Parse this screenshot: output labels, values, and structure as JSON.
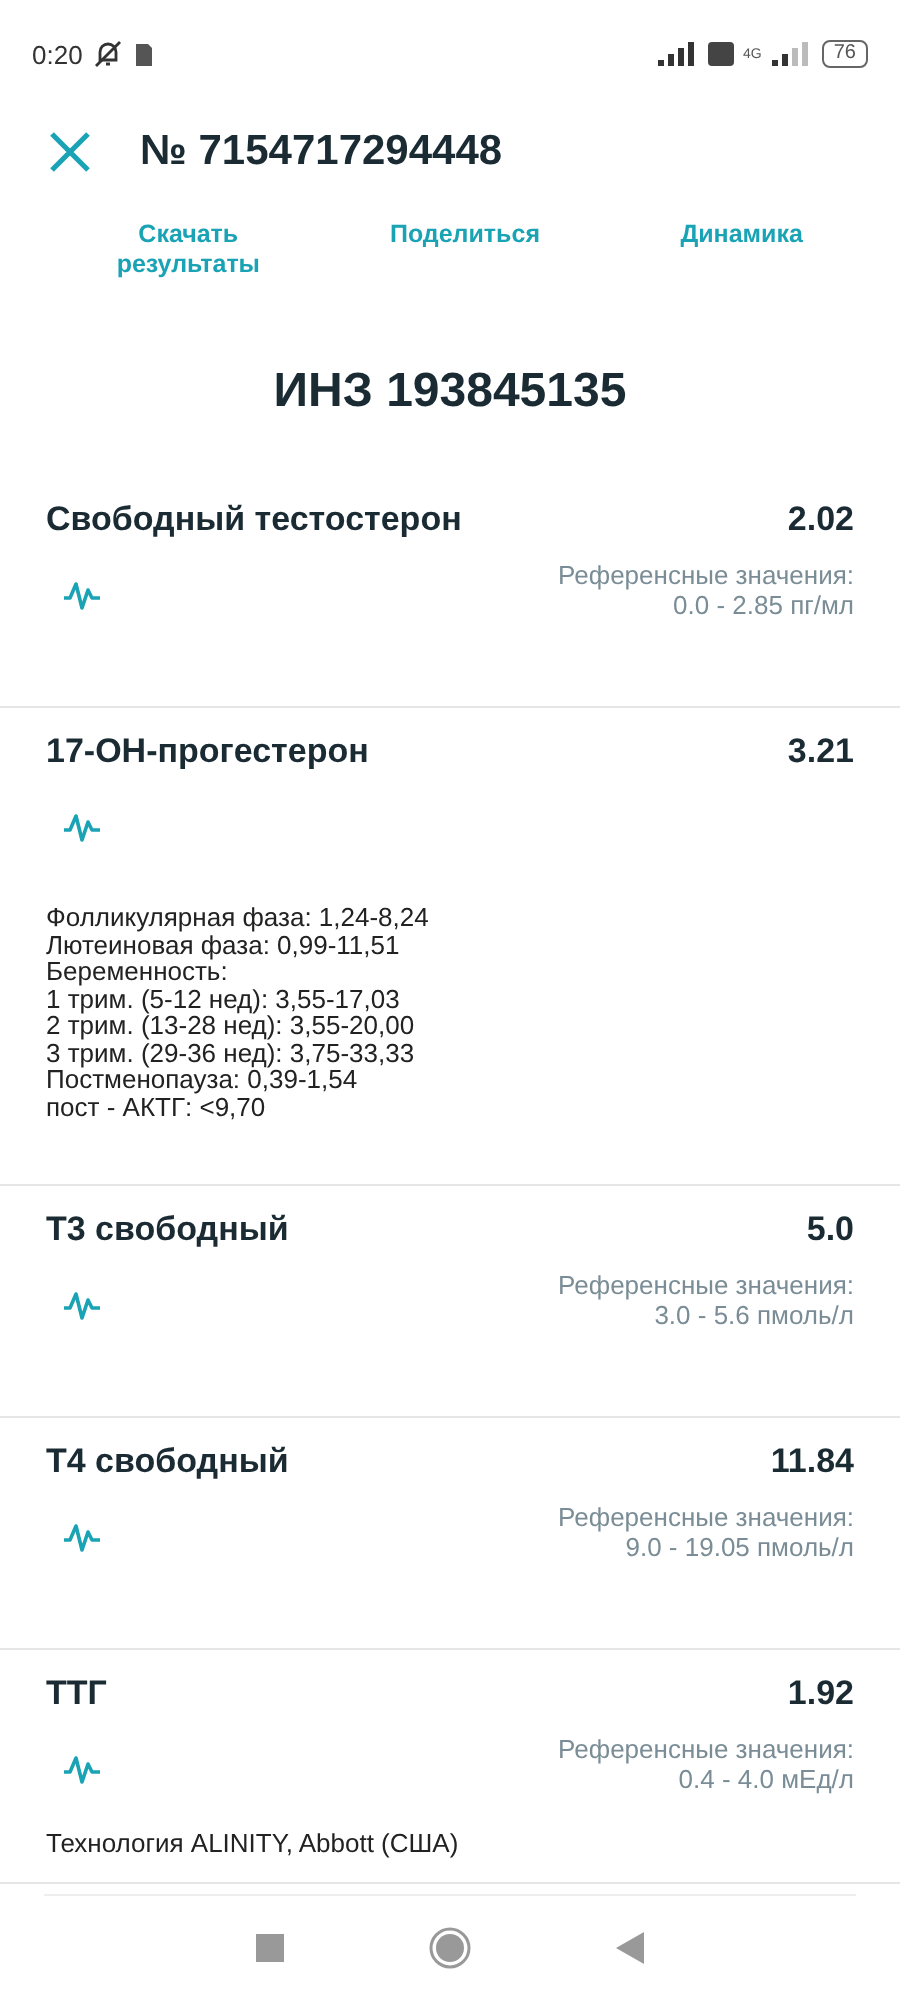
{
  "status_bar": {
    "time": "0:20",
    "network": "4G",
    "battery": "76"
  },
  "header": {
    "title": "№ 7154717294448"
  },
  "actions": [
    {
      "label": "Скачать\nрезультаты"
    },
    {
      "label": "Поделиться"
    },
    {
      "label": "Динамика"
    }
  ],
  "heading": "ИНЗ 193845135",
  "results": [
    {
      "name": "Свободный тестостерон",
      "value": "2.02",
      "ref_label": "Референсные значения:",
      "ref_value": "0.0 - 2.85 пг/мл"
    },
    {
      "name": "17-ОН-прогестерон",
      "value": "3.21",
      "note": [
        "Фолликулярная фаза: 1,24-8,24",
        "Лютеиновая фаза: 0,99-11,51",
        "Беременность:",
        "1 трим. (5-12 нед): 3,55-17,03",
        "2 трим. (13-28 нед): 3,55-20,00",
        "3 трим. (29-36 нед):  3,75-33,33",
        "Постменопауза: 0,39-1,54",
        "пост - АКТГ: <9,70"
      ]
    },
    {
      "name": "T3 свободный",
      "value": "5.0",
      "ref_label": "Референсные значения:",
      "ref_value": "3.0 - 5.6 пмоль/л"
    },
    {
      "name": "T4 свободный",
      "value": "11.84",
      "ref_label": "Референсные значения:",
      "ref_value": "9.0 - 19.05 пмоль/л"
    },
    {
      "name": "ТТГ",
      "value": "1.92",
      "ref_label": "Референсные значения:",
      "ref_value": "0.4 - 4.0 мЕд/л",
      "note": [
        "Технология ALINITY, Abbott (США)"
      ]
    }
  ]
}
